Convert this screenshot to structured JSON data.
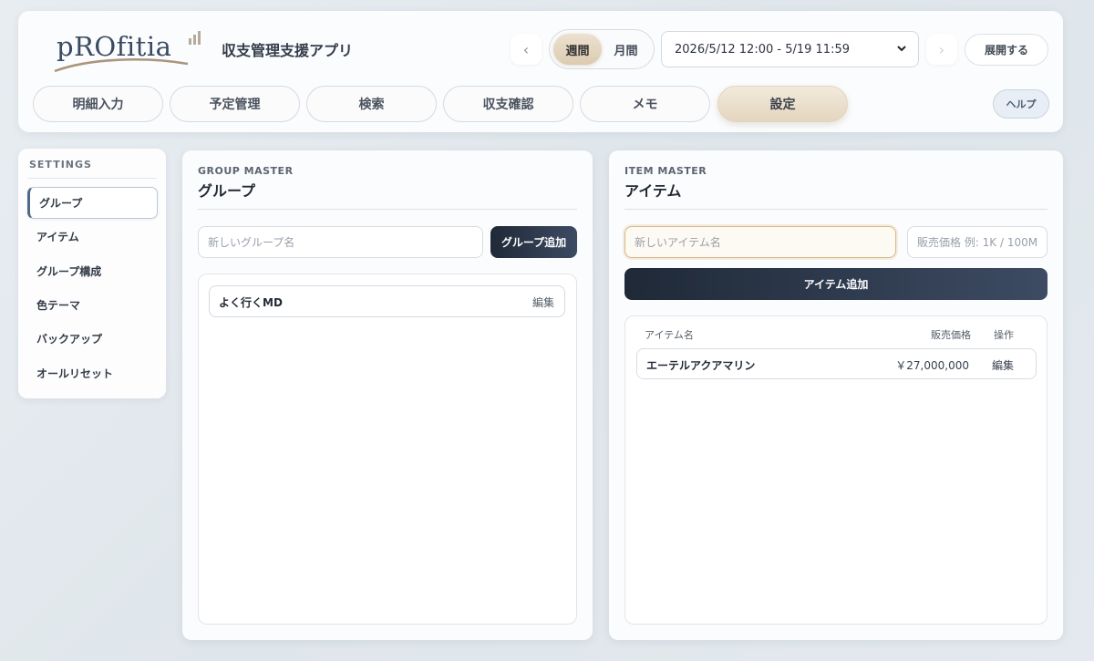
{
  "app": {
    "logo_text": "pROfitia",
    "title": "収支管理支援アプリ"
  },
  "period": {
    "prev_icon": "chevron-left-icon",
    "next_icon": "chevron-right-icon",
    "weekly": "週間",
    "monthly": "月間",
    "selected": "weekly",
    "range": "2026/5/12 12:00 - 5/19 11:59",
    "expand_label": "展開する"
  },
  "tabs": [
    {
      "label": "明細入力",
      "active": false
    },
    {
      "label": "予定管理",
      "active": false
    },
    {
      "label": "検索",
      "active": false
    },
    {
      "label": "収支確認",
      "active": false
    },
    {
      "label": "メモ",
      "active": false
    },
    {
      "label": "設定",
      "active": true
    }
  ],
  "help_label": "ヘルプ",
  "sidebar": {
    "heading": "SETTINGS",
    "items": [
      {
        "label": "グループ",
        "active": true
      },
      {
        "label": "アイテム",
        "active": false
      },
      {
        "label": "グループ構成",
        "active": false
      },
      {
        "label": "色テーマ",
        "active": false
      },
      {
        "label": "バックアップ",
        "active": false
      },
      {
        "label": "オールリセット",
        "active": false
      }
    ]
  },
  "group_master": {
    "subtitle": "GROUP MASTER",
    "title": "グループ",
    "input_placeholder": "新しいグループ名",
    "add_label": "グループ追加",
    "groups": [
      {
        "name": "よく行くMD",
        "edit": "編集"
      }
    ]
  },
  "item_master": {
    "subtitle": "ITEM MASTER",
    "title": "アイテム",
    "name_placeholder": "新しいアイテム名",
    "price_placeholder": "販売価格 例: 1K / 100M",
    "add_label": "アイテム追加",
    "columns": {
      "name": "アイテム名",
      "price": "販売価格",
      "action": "操作"
    },
    "items": [
      {
        "name": "エーテルアクアマリン",
        "price": "￥27,000,000",
        "edit": "編集"
      }
    ]
  },
  "colors": {
    "accent_tan": "#e4d6bf",
    "button_dark": "#1f2937",
    "focus_border": "#d9b985"
  }
}
